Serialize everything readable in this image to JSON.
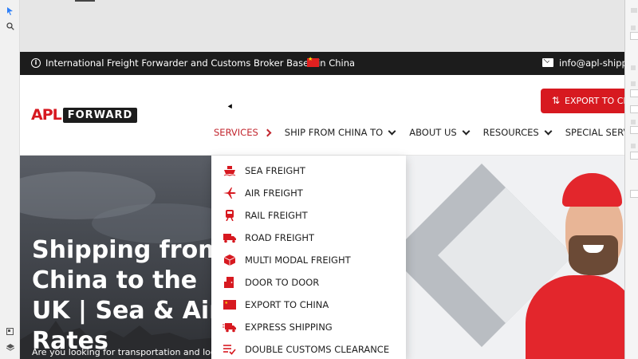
{
  "colors": {
    "brand_red": "#d71920",
    "topbar_bg": "#1c1c1c",
    "nav_active": "#c2262e"
  },
  "topbar": {
    "info_text": "International Freight Forwarder and Customs Broker Based in China",
    "email": "info@apl-shippin"
  },
  "logo": {
    "apl": "APL",
    "forward": "FORWARD"
  },
  "cta": {
    "label": "EXPORT TO CHIN",
    "icon": "swap-vertical-icon"
  },
  "nav": {
    "items": [
      {
        "label": "SERVICES",
        "active": true
      },
      {
        "label": "SHIP FROM CHINA TO"
      },
      {
        "label": "ABOUT US"
      },
      {
        "label": "RESOURCES"
      },
      {
        "label": "SPECIAL SERVICE"
      }
    ]
  },
  "dropdown": {
    "items": [
      {
        "label": "SEA FREIGHT",
        "icon": "ship-icon"
      },
      {
        "label": "AIR FREIGHT",
        "icon": "plane-icon"
      },
      {
        "label": "RAIL FREIGHT",
        "icon": "train-icon"
      },
      {
        "label": "ROAD FREIGHT",
        "icon": "truck-icon"
      },
      {
        "label": "MULTI MODAL FREIGHT",
        "icon": "cube-icon"
      },
      {
        "label": "DOOR TO DOOR",
        "icon": "door-icon"
      },
      {
        "label": "EXPORT TO CHINA",
        "icon": "china-flag-icon"
      },
      {
        "label": "EXPRESS SHIPPING",
        "icon": "fast-truck-icon"
      },
      {
        "label": "DOUBLE CUSTOMS CLEARANCE",
        "icon": "checklist-icon"
      }
    ]
  },
  "hero": {
    "title": "Shipping from China to the UK | Sea & Air Rates",
    "subtitle": "Are you looking for transportation and logistics"
  }
}
